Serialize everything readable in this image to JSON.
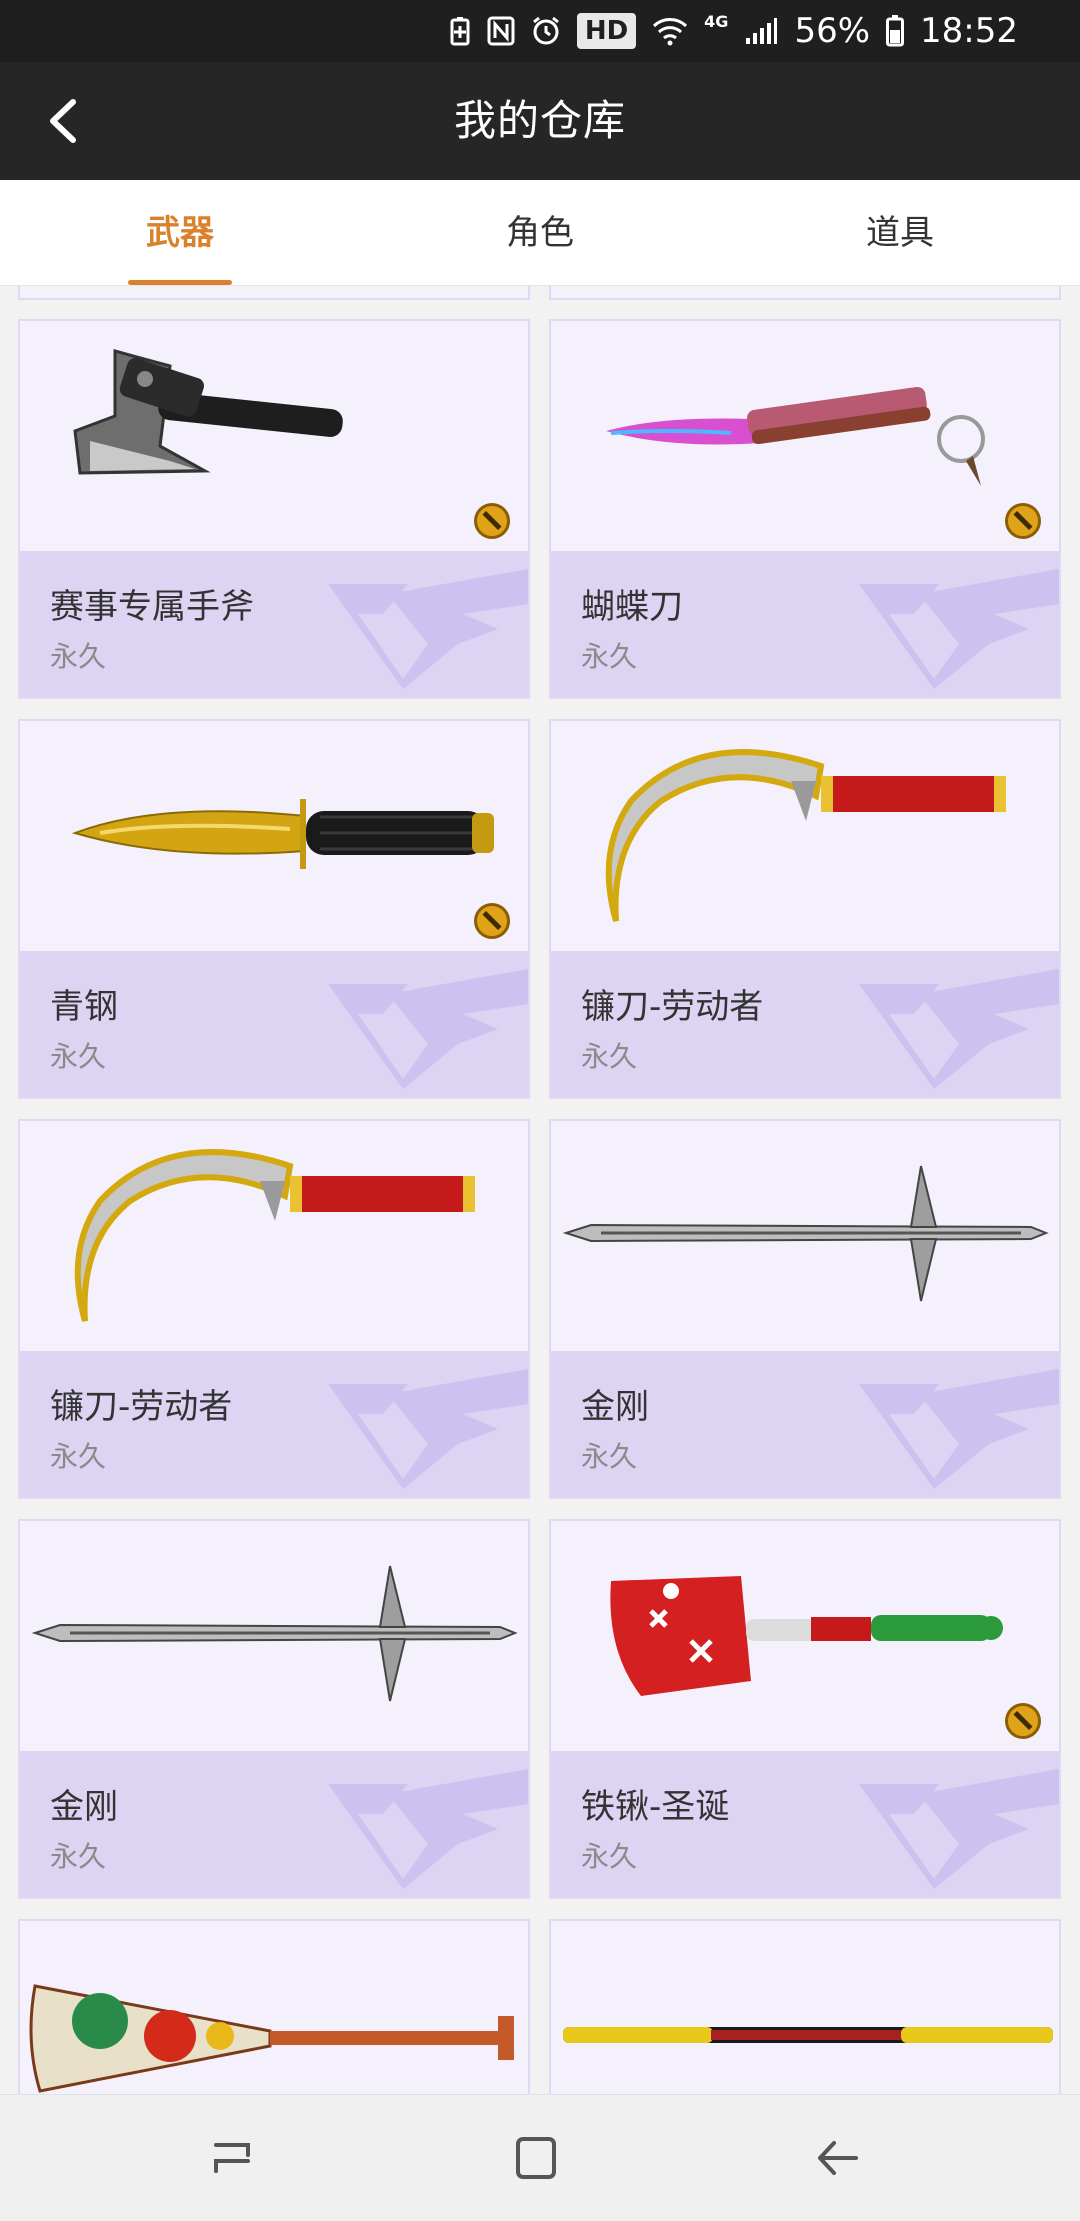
{
  "status_bar": {
    "hd": "HD",
    "network": "4G",
    "battery": "56%",
    "time": "18:52"
  },
  "header": {
    "title": "我的仓库"
  },
  "tabs": [
    {
      "label": "武器",
      "active": true
    },
    {
      "label": "角色",
      "active": false
    },
    {
      "label": "道具",
      "active": false
    }
  ],
  "items": [
    {
      "name": "赛事专属手斧",
      "duration": "永久",
      "has_badge": true,
      "image_icon": "hand-axe"
    },
    {
      "name": "蝴蝶刀",
      "duration": "永久",
      "has_badge": true,
      "image_icon": "butterfly-knife"
    },
    {
      "name": "青钢",
      "duration": "永久",
      "has_badge": true,
      "image_icon": "combat-knife"
    },
    {
      "name": "镰刀-劳动者",
      "duration": "永久",
      "has_badge": false,
      "image_icon": "sickle"
    },
    {
      "name": "镰刀-劳动者",
      "duration": "永久",
      "has_badge": false,
      "image_icon": "sickle"
    },
    {
      "name": "金刚",
      "duration": "永久",
      "has_badge": false,
      "image_icon": "spiked-sword"
    },
    {
      "name": "金刚",
      "duration": "永久",
      "has_badge": false,
      "image_icon": "spiked-sword"
    },
    {
      "name": "铁锹-圣诞",
      "duration": "永久",
      "has_badge": true,
      "image_icon": "christmas-shovel"
    }
  ],
  "colors": {
    "accent": "#d9822b",
    "header_bg": "#262626",
    "card_bg": "#f5f1fc",
    "card_info_bg": "#ddd3f3",
    "badge": "#e0a318"
  }
}
